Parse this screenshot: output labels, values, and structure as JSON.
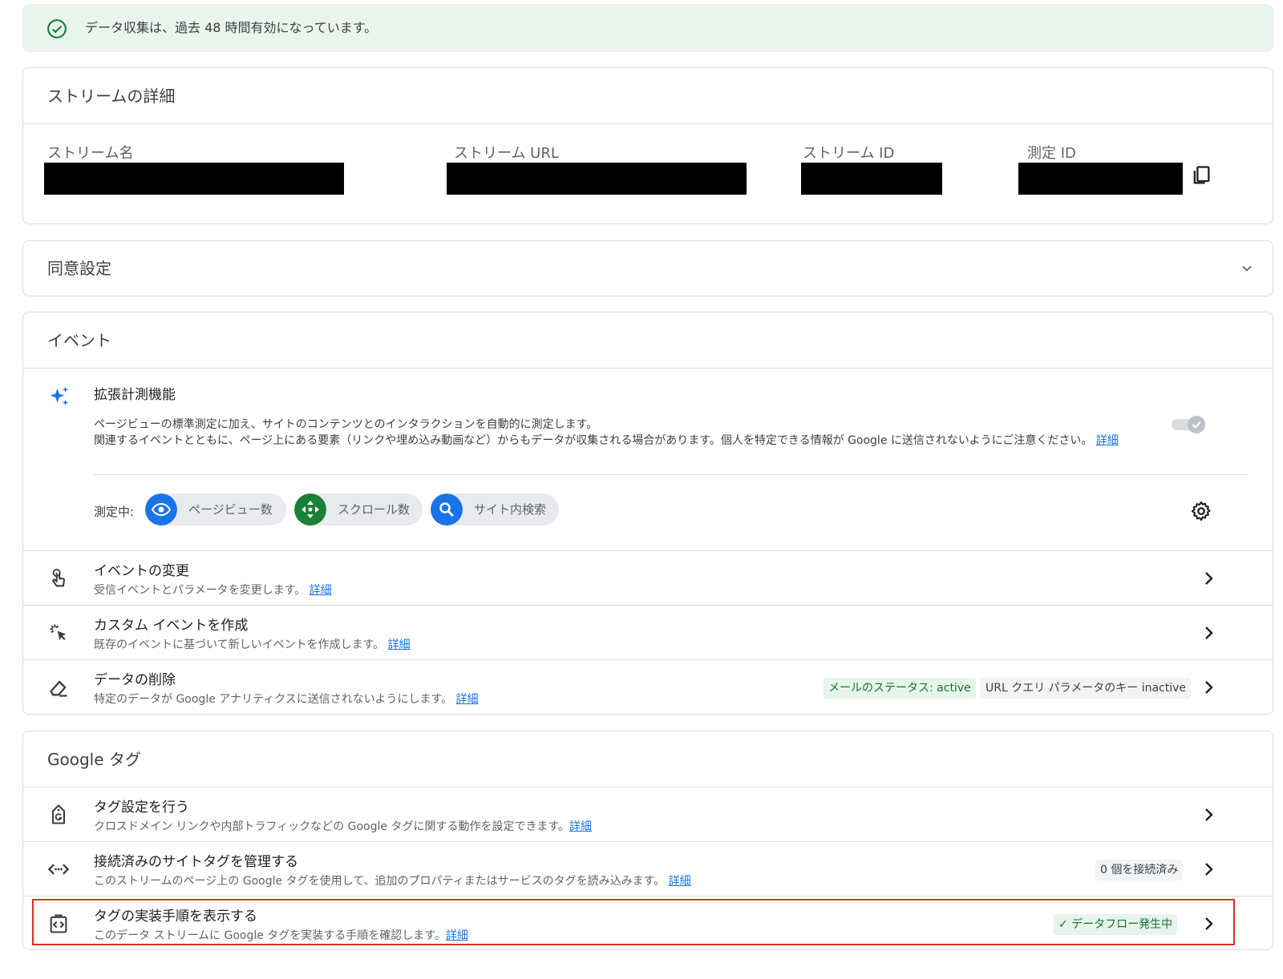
{
  "banner": {
    "icon": "check-circle-icon",
    "text": "データ収集は、過去 48 時間有効になっています。"
  },
  "stream_details": {
    "title": "ストリームの詳細",
    "fields": [
      {
        "label": "ストリーム名"
      },
      {
        "label": "ストリーム URL"
      },
      {
        "label": "ストリーム ID"
      },
      {
        "label": "測定 ID"
      }
    ]
  },
  "consent": {
    "title": "同意設定"
  },
  "events": {
    "title": "イベント",
    "enhanced": {
      "title": "拡張計測機能",
      "desc_line1": "ページビューの標準測定に加え、サイトのコンテンツとのインタラクションを自動的に測定します。",
      "desc_line2": "関連するイベントとともに、ページ上にある要素（リンクや埋め込み動画など）からもデータが収集される場合があります。個人を特定できる情報が Google に送信されないようにご注意ください。",
      "link": "詳細",
      "measuring_label": "測定中:",
      "chips": [
        {
          "label": "ページビュー数",
          "icon": "eye-icon",
          "color": "#1a73e8"
        },
        {
          "label": "スクロール数",
          "icon": "scroll-arrows-icon",
          "color": "#188038"
        },
        {
          "label": "サイト内検索",
          "icon": "search-icon",
          "color": "#1a73e8"
        }
      ]
    },
    "rows": [
      {
        "title": "イベントの変更",
        "desc": "受信イベントとパラメータを変更します。",
        "link": "詳細"
      },
      {
        "title": "カスタム イベントを作成",
        "desc": "既存のイベントに基づいて新しいイベントを作成します。",
        "link": "詳細"
      },
      {
        "title": "データの削除",
        "desc": "特定のデータが Google アナリティクスに送信されないようにします。",
        "link": "詳細",
        "badge1": "メールのステータス: active",
        "badge2": "URL クエリ パラメータのキー inactive"
      }
    ]
  },
  "google_tag": {
    "title": "Google タグ",
    "rows": [
      {
        "title": "タグ設定を行う",
        "desc": "クロスドメイン リンクや内部トラフィックなどの Google タグに関する動作を設定できます。",
        "link": "詳細"
      },
      {
        "title": "接続済みのサイトタグを管理する",
        "desc": "このストリームのページ上の Google タグを使用して、追加のプロパティまたはサービスのタグを読み込みます。",
        "link": "詳細",
        "badge": "0 個を接続済み"
      },
      {
        "title": "タグの実装手順を表示する",
        "desc": "このデータ ストリームに Google タグを実装する手順を確認します。",
        "link": "詳細",
        "badge": "データフロー発生中"
      }
    ]
  }
}
